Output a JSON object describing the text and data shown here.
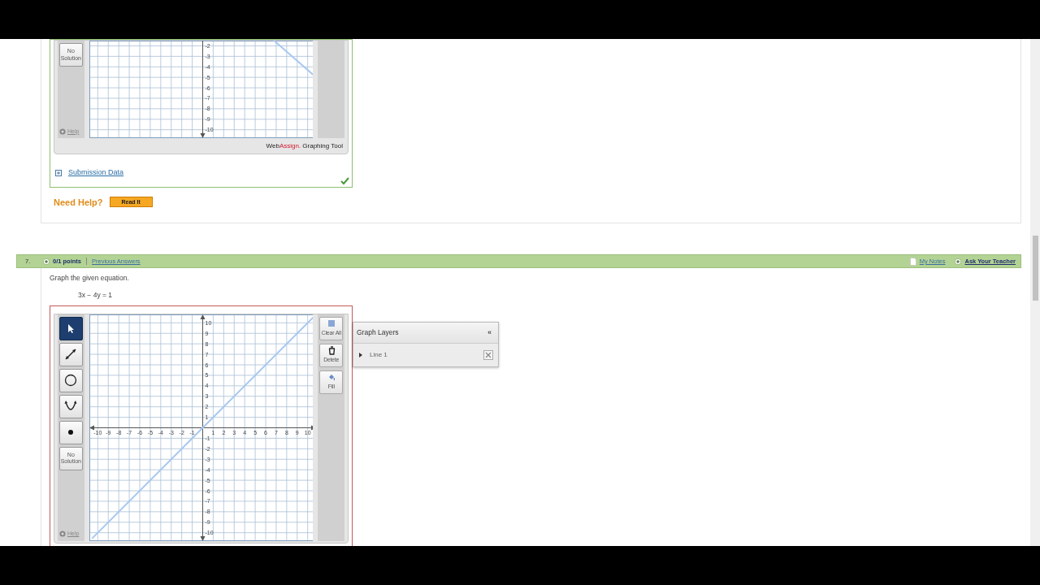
{
  "questions": [
    {
      "answer": {
        "correct": true,
        "graph_tool": {
          "tools": [
            {
              "kind": "no_solution",
              "label": "No Solution",
              "selected": false
            }
          ],
          "help": "Help",
          "brand": [
            "Web",
            "Assign.",
            "Graphing Tool"
          ],
          "chart_data": {
            "type": "line",
            "grid": true,
            "xlim": [
              -10.8,
              10.8
            ],
            "ylim": [
              -10.8,
              -1.5
            ],
            "yticks": [
              -2,
              -3,
              -4,
              -5,
              -6,
              -7,
              -8,
              -9,
              -10
            ],
            "x": [
              6.8,
              10.8
            ],
            "series": [
              {
                "color": "#a9c8f0",
                "values": [
                  -1.5,
                  -5.0
                ]
              }
            ]
          }
        },
        "submission": "Submission Data"
      },
      "need_help": "Need Help?",
      "help_buttons": [
        "Read It"
      ]
    },
    {
      "number": "7.",
      "points": "0/1 points",
      "previous": "Previous Answers",
      "notes": "My Notes",
      "ask": "Ask Your Teacher",
      "prompt": "Graph the given equation.",
      "equation": "3x − 4y = 1",
      "answer": {
        "correct": false,
        "graph_tool": {
          "tools": [
            {
              "kind": "select",
              "selected": true
            },
            {
              "kind": "line",
              "selected": false
            },
            {
              "kind": "circle",
              "selected": false
            },
            {
              "kind": "parabola",
              "selected": false
            },
            {
              "kind": "point",
              "selected": false
            },
            {
              "kind": "no_solution",
              "label": "No Solution",
              "selected": false
            }
          ],
          "help": "Help",
          "side_buttons": [
            {
              "kind": "clear",
              "label": "Clear All"
            },
            {
              "kind": "delete",
              "label": "Delete"
            },
            {
              "kind": "fill",
              "label": "Fill"
            }
          ],
          "chart_data": {
            "type": "line",
            "grid": true,
            "xlim": [
              -10.8,
              10.8
            ],
            "ylim": [
              -10.8,
              10.8
            ],
            "xticks": [
              -10,
              -9,
              -8,
              -7,
              -6,
              -5,
              -4,
              -3,
              -2,
              -1,
              1,
              2,
              3,
              4,
              5,
              6,
              7,
              8,
              9,
              10
            ],
            "yticks": [
              10,
              9,
              8,
              7,
              6,
              5,
              4,
              3,
              2,
              1,
              -1,
              -2,
              -3,
              -4,
              -5,
              -6,
              -7,
              -8,
              -9,
              -10
            ],
            "x": [
              -10.5,
              10.5
            ],
            "series": [
              {
                "color": "#a9c8f0",
                "values": [
                  -10.5,
                  10.5
                ]
              }
            ]
          },
          "layers": {
            "title": "Graph Layers",
            "collapse": "«",
            "items": [
              {
                "label": "Line 1",
                "expanded": false
              }
            ]
          }
        }
      }
    }
  ]
}
